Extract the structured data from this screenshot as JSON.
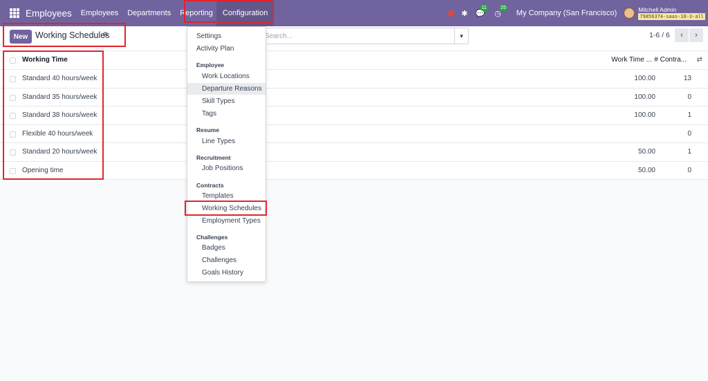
{
  "navbar": {
    "brand": "Employees",
    "menu": [
      "Employees",
      "Departments",
      "Reporting",
      "Configuration"
    ],
    "chat_count": "11",
    "activity_count": "25",
    "company": "My Company (San Francisco)",
    "user_name": "Mitchell Admin",
    "database": "79856374-saas-18-3-all"
  },
  "control": {
    "new_label": "New",
    "title": "Working Schedules",
    "search_placeholder": "Search...",
    "pager": "1-6 / 6"
  },
  "list": {
    "columns": [
      "Working Time",
      "Work Time ...",
      "# Contra..."
    ],
    "rows": [
      {
        "name": "Standard 40 hours/week",
        "work": "100.00",
        "contracts": "13"
      },
      {
        "name": "Standard 35 hours/week",
        "work": "100.00",
        "contracts": "0"
      },
      {
        "name": "Standard 38 hours/week",
        "work": "100.00",
        "contracts": "1"
      },
      {
        "name": "Flexible 40 hours/week",
        "work": "",
        "contracts": "0"
      },
      {
        "name": "Standard 20 hours/week",
        "work": "50.00",
        "contracts": "1"
      },
      {
        "name": "Opening time",
        "work": "50.00",
        "contracts": "0"
      }
    ]
  },
  "dropdown": {
    "settings": "Settings",
    "activity_plan": "Activity Plan",
    "employee_header": "Employee",
    "work_locations": "Work Locations",
    "departure_reasons": "Departure Reasons",
    "skill_types": "Skill Types",
    "tags": "Tags",
    "resume_header": "Resume",
    "line_types": "Line Types",
    "recruitment_header": "Recruitment",
    "job_positions": "Job Positions",
    "contracts_header": "Contracts",
    "templates": "Templates",
    "working_schedules": "Working Schedules",
    "employment_types": "Employment Types",
    "challenges_header": "Challenges",
    "badges": "Badges",
    "challenges": "Challenges",
    "goals_history": "Goals History"
  },
  "colors": {
    "navbar": "#71639e",
    "highlight": "#e0242b"
  }
}
